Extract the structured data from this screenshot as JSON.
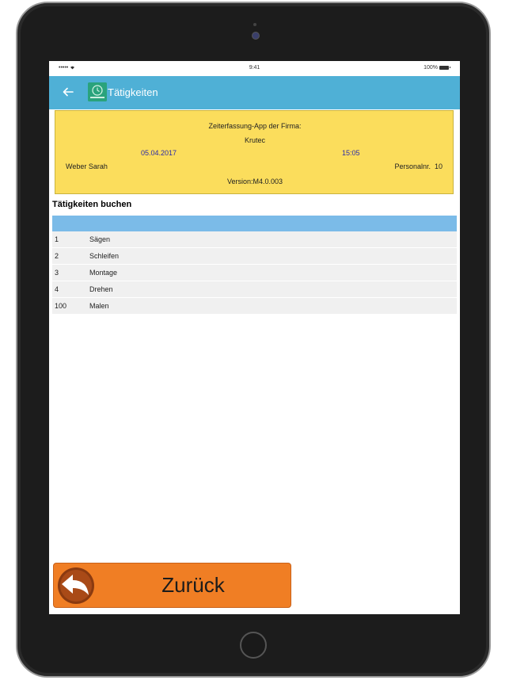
{
  "status_bar": {
    "signal": "•••••",
    "time": "9:41",
    "battery": "100%"
  },
  "app_bar": {
    "title": "Tätigkeiten"
  },
  "info": {
    "company_caption": "Zeiterfassung-App der Firma:",
    "company_name": "Krutec",
    "date": "05.04.2017",
    "time": "15:05",
    "employee_name": "Weber Sarah",
    "personnel_label": "Personalnr.",
    "personnel_number": "10",
    "version": "Version:M4.0.003"
  },
  "section": {
    "title": "Tätigkeiten buchen"
  },
  "activities": [
    {
      "number": "1",
      "name": "Sägen"
    },
    {
      "number": "2",
      "name": "Schleifen"
    },
    {
      "number": "3",
      "name": "Montage"
    },
    {
      "number": "4",
      "name": "Drehen"
    },
    {
      "number": "100",
      "name": "Malen"
    }
  ],
  "footer": {
    "back_label": "Zurück"
  },
  "colors": {
    "app_bar": "#4fb0d6",
    "info_background": "#fbdd5c",
    "table_header": "#7bbbe8",
    "back_button": "#f07e24"
  }
}
